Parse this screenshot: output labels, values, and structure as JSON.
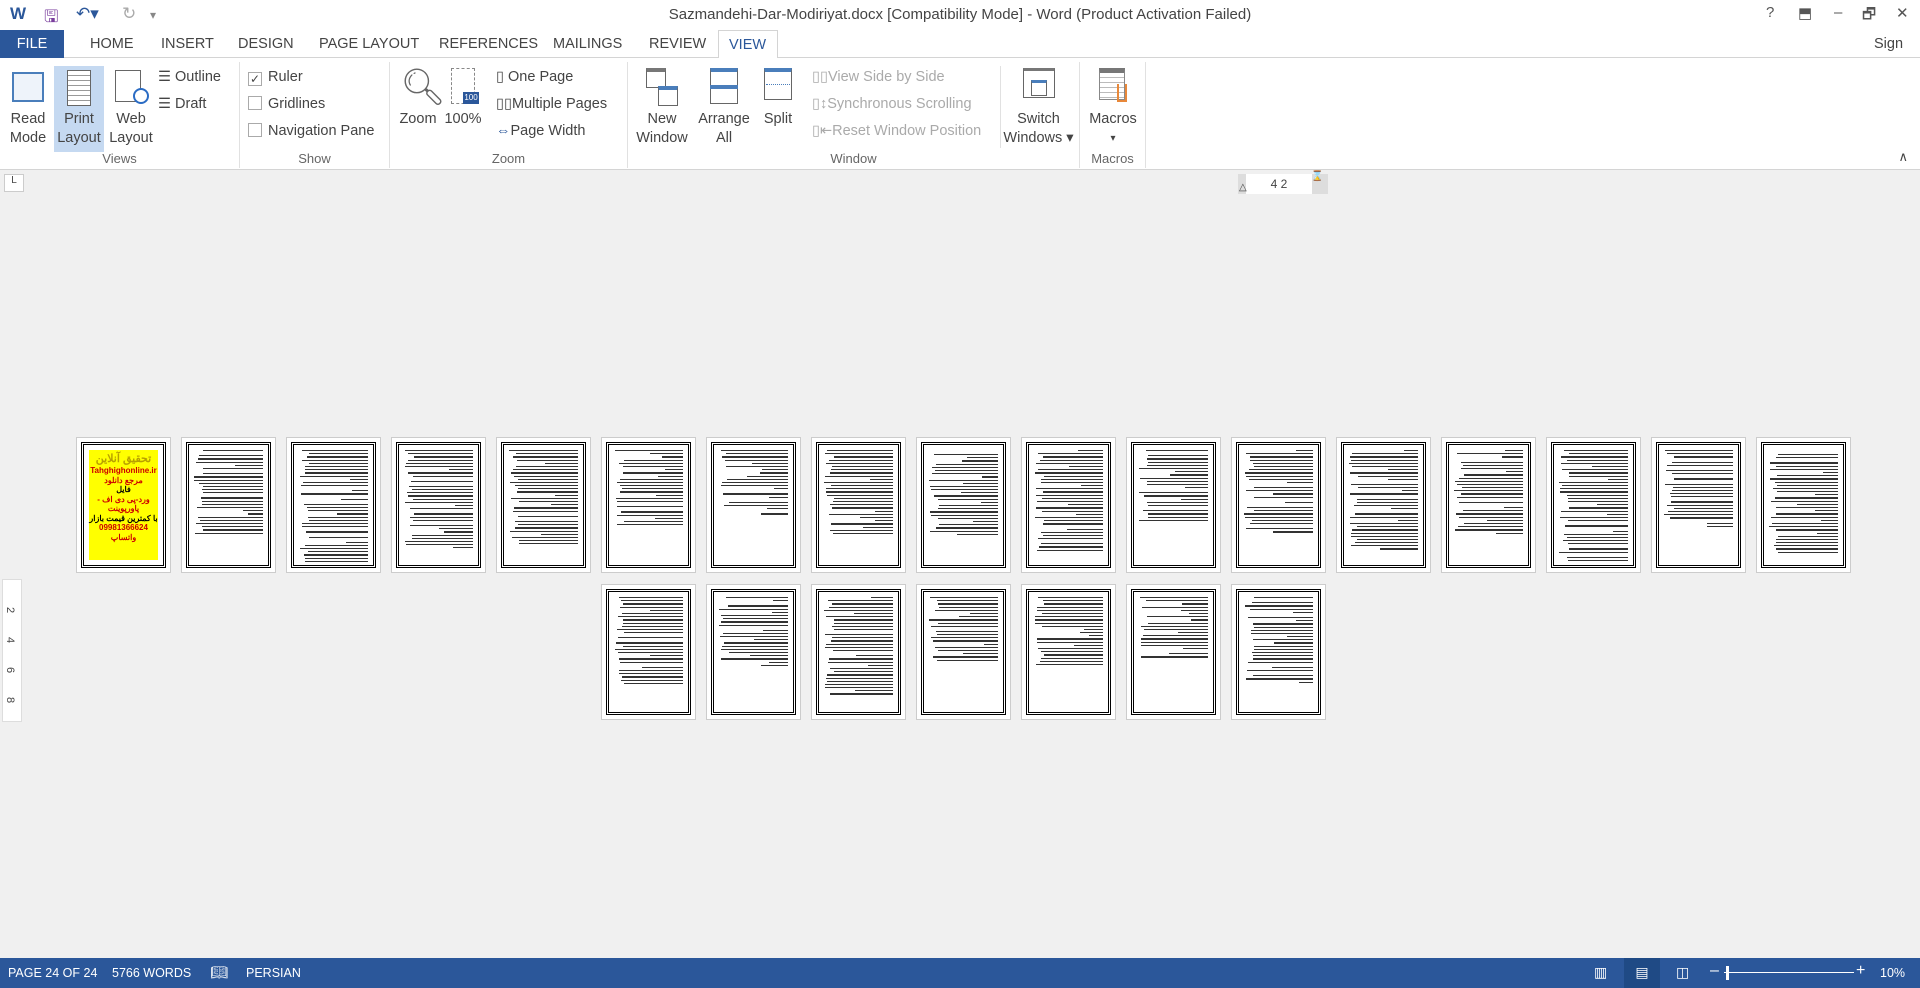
{
  "title": "Sazmandehi-Dar-Modiriyat.docx [Compatibility Mode] - Word (Product Activation Failed)",
  "window_controls": {
    "help": "?",
    "ribbon_display": "⬒",
    "minimize": "–",
    "restore": "🗗",
    "close": "✕"
  },
  "sign_in": "Sign in",
  "tabs": [
    "FILE",
    "HOME",
    "INSERT",
    "DESIGN",
    "PAGE LAYOUT",
    "REFERENCES",
    "MAILINGS",
    "REVIEW",
    "VIEW"
  ],
  "active_tab": "VIEW",
  "ribbon": {
    "views": {
      "label": "Views",
      "read_mode": [
        "Read",
        "Mode"
      ],
      "print_layout": [
        "Print",
        "Layout"
      ],
      "web_layout": [
        "Web",
        "Layout"
      ],
      "outline": "Outline",
      "draft": "Draft"
    },
    "show": {
      "label": "Show",
      "ruler": "Ruler",
      "ruler_checked": true,
      "gridlines": "Gridlines",
      "gridlines_checked": false,
      "navigation_pane": "Navigation Pane",
      "navigation_pane_checked": false
    },
    "zoom": {
      "label": "Zoom",
      "zoom": "Zoom",
      "hundred": "100%",
      "one_page": "One Page",
      "multiple_pages": "Multiple Pages",
      "page_width": "Page Width"
    },
    "window": {
      "label": "Window",
      "new_window": [
        "New",
        "Window"
      ],
      "arrange_all": [
        "Arrange",
        "All"
      ],
      "split": "Split",
      "view_side_by_side": "View Side by Side",
      "synchronous_scrolling": "Synchronous Scrolling",
      "reset_window_position": "Reset Window Position",
      "switch_windows": [
        "Switch",
        "Windows ▾"
      ]
    },
    "macros": {
      "label": "Macros",
      "macros": "Macros",
      "arrow": "▾"
    }
  },
  "ruler": {
    "h_numbers": "4   2",
    "v_numbers": [
      "2",
      "4",
      "6",
      "8"
    ]
  },
  "cover_page": {
    "lines": [
      "تحقیق آنلاین",
      "Tahghighonline.ir",
      "مرجع دانلود",
      "فایل",
      "ورد-پی دی اف - پاورپوینت",
      "با کمترین قیمت بازار",
      "09981366624 واتساپ"
    ]
  },
  "page_count": 24,
  "status": {
    "page": "PAGE 24 OF 24",
    "words": "5766 WORDS",
    "language": "PERSIAN",
    "zoom": "10%",
    "zoom_percent": 10
  },
  "colors": {
    "accent": "#2b579a",
    "selected": "#c5d9f1",
    "cover": "#ffff00"
  }
}
